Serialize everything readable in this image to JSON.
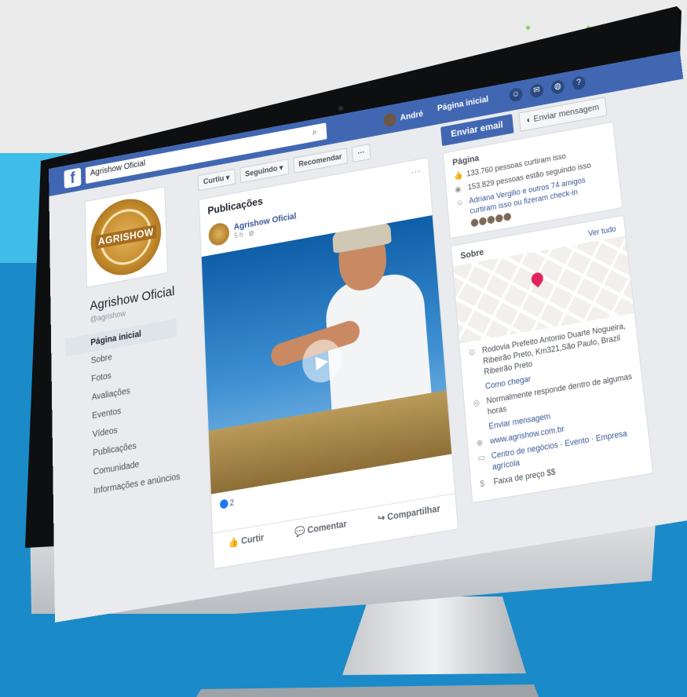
{
  "colors": {
    "fb_blue": "#4267b2",
    "link": "#385898",
    "cyan": "#3fbde8",
    "blue_bg": "#1a8ac9"
  },
  "topbar": {
    "logo_icon": "facebook-icon",
    "search_value": "Agrishow Oficial",
    "user_name": "André",
    "home_label": "Página inicial"
  },
  "sidebar": {
    "logo_text": "AGRISHOW",
    "page_name": "Agrishow Oficial",
    "handle": "@agrishow",
    "items": [
      {
        "label": "Página inicial"
      },
      {
        "label": "Sobre"
      },
      {
        "label": "Fotos"
      },
      {
        "label": "Avaliações"
      },
      {
        "label": "Eventos"
      },
      {
        "label": "Vídeos"
      },
      {
        "label": "Publicações"
      },
      {
        "label": "Comunidade"
      },
      {
        "label": "Informações e anúncios"
      }
    ]
  },
  "actions": {
    "curtir": "Curtiu ▾",
    "seguindo": "Seguindo ▾",
    "recomendar": "Recomendar",
    "more": "···"
  },
  "post": {
    "heading": "Publicações",
    "author": "Agrishow Oficial",
    "time": "5 h · ◍",
    "more": "···",
    "reactions_count": "2",
    "like_label": "Curtir",
    "comment_label": "Comentar",
    "share_label": "Compartilhar"
  },
  "right": {
    "send_email": "Enviar email",
    "send_message": "Enviar mensagem",
    "page_title": "Página",
    "likes": "133.760 pessoas curtiram isso",
    "followers": "153.829 pessoas estão seguindo isso",
    "friends": "Adriana Vergilio e outros 74 amigos curtiram isso ou fizeram check-in",
    "see_all": "Ver tudo",
    "about_title": "Sobre",
    "address": "Rodovia Prefeito Antonio Duarte Nogueira, Ribeirão Preto, Km321,São Paulo, Brazil Ribeirão Preto",
    "directions": "Como chegar",
    "response": "Normalmente responde dentro de algumas horas",
    "send_message_link": "Enviar mensagem",
    "website": "www.agrishow.com.br",
    "category": "Centro de negócios · Evento · Empresa agrícola",
    "price": "Faixa de preço $$"
  }
}
